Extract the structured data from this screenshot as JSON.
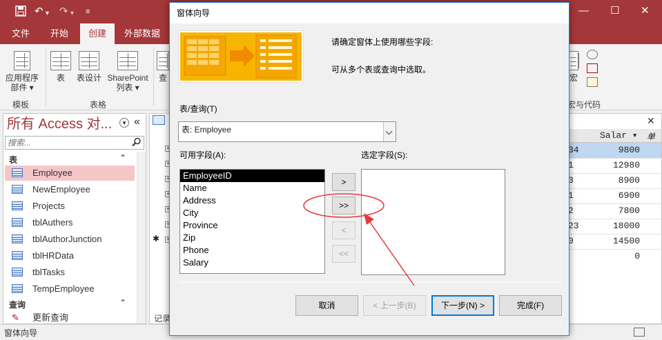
{
  "app": {
    "quick_access": {
      "save_icon": "save-icon",
      "undo_icon": "undo-icon",
      "redo_icon": "redo-icon",
      "customize_icon": "customize-icon"
    },
    "window_controls": {
      "minimize": "—",
      "maximize": "☐",
      "close": "✕"
    }
  },
  "ribbon": {
    "tabs": [
      {
        "label": "文件"
      },
      {
        "label": "开始"
      },
      {
        "label": "创建",
        "active": true
      },
      {
        "label": "外部数据"
      }
    ],
    "buttons": {
      "app_parts": "应用程序",
      "app_parts_line2": "部件 ▾",
      "table": "表",
      "table_design": "表设计",
      "sharepoint": "SharePoint",
      "sharepoint_line2": "列表 ▾",
      "query_partial": "查",
      "macro_partial": "宏"
    },
    "groups": {
      "templates": "模板",
      "tables": "表格",
      "macros_code_partial": "宏与代码"
    }
  },
  "nav": {
    "title": "所有 Access 对...",
    "search_placeholder": "搜索...",
    "section_tables": "表",
    "section_queries": "查询",
    "items": [
      {
        "label": "Employee",
        "selected": true
      },
      {
        "label": "NewEmployee"
      },
      {
        "label": "Projects"
      },
      {
        "label": "tblAuthers"
      },
      {
        "label": "tblAuthorJunction"
      },
      {
        "label": "tblHRData"
      },
      {
        "label": "tblTasks"
      },
      {
        "label": "TempEmployee"
      }
    ],
    "query_item": "更新查询",
    "collapse_glyph": "«",
    "chevron_up": "⌃"
  },
  "datasheet": {
    "header_salary": "Salar ▾",
    "header_next": "单击",
    "rows": [
      {
        "left": "34",
        "salary": "9800",
        "selected": true
      },
      {
        "left": "1",
        "salary": "12980"
      },
      {
        "left": "3",
        "salary": "8900"
      },
      {
        "left": "1",
        "salary": "6900"
      },
      {
        "left": "2",
        "salary": "7800"
      },
      {
        "left": "23",
        "salary": "18000"
      },
      {
        "left": "0",
        "salary": "14500"
      },
      {
        "left": "",
        "salary": "0"
      }
    ],
    "record_label": "记录",
    "close_glyph": "✕",
    "new_row_glyph": "✱"
  },
  "status": {
    "text": "窗体向导"
  },
  "dialog": {
    "title": "窗体向导",
    "prompt1": "请确定窗体上使用哪些字段:",
    "prompt2": "可从多个表或查询中选取。",
    "table_query_label": "表/查询(T)",
    "table_query_value": "表: Employee",
    "available_label": "可用字段(A):",
    "selected_label": "选定字段(S):",
    "available_fields": [
      {
        "label": "EmployeeID",
        "selected": true
      },
      {
        "label": "Name"
      },
      {
        "label": "Address"
      },
      {
        "label": "City"
      },
      {
        "label": "Province"
      },
      {
        "label": "Zip"
      },
      {
        "label": "Phone"
      },
      {
        "label": "Salary"
      }
    ],
    "move_buttons": {
      "add": ">",
      "add_all": ">>",
      "remove": "<",
      "remove_all": "<<"
    },
    "buttons": {
      "cancel": "取消",
      "back": "< 上一步(B)",
      "next": "下一步(N) >",
      "finish": "完成(F)"
    }
  },
  "annotations": {
    "highlight_color": "#e5393d"
  },
  "colors": {
    "access_accent": "#a4373a",
    "selection": "#f4c6c8",
    "dialog_border": "#2c7fd4"
  }
}
